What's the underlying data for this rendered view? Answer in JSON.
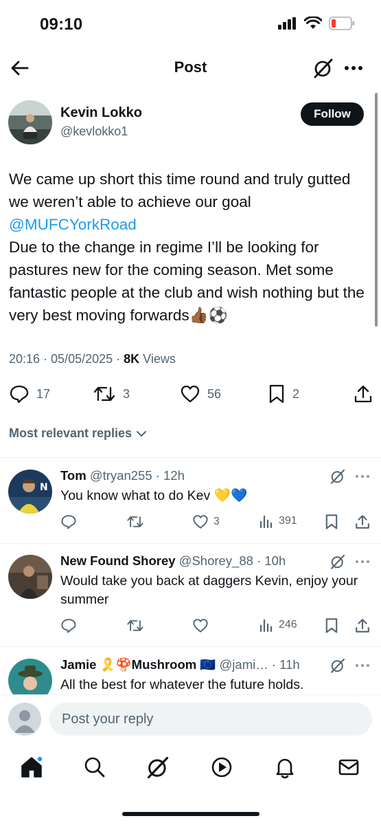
{
  "status_bar": {
    "time": "09:10"
  },
  "header": {
    "title": "Post"
  },
  "author": {
    "name": "Kevin Lokko",
    "handle": "@kevlokko1",
    "follow_label": "Follow"
  },
  "post": {
    "line1": "We came up short this time round and truly gutted we weren’t able to achieve our goal",
    "mention": "@MUFCYorkRoad",
    "line2": "Due to the change in regime I’ll be looking for pastures new for the coming season. Met some fantastic people at the club and wish nothing but the very best moving forwards👍🏾⚽️",
    "timestamp": "20:16 · 05/05/2025 · ",
    "views_count": "8K",
    "views_label": " Views"
  },
  "stats": {
    "replies": "17",
    "reposts": "3",
    "likes": "56",
    "bookmarks": "2"
  },
  "sort_label": "Most relevant replies",
  "replies": [
    {
      "name": "Tom",
      "handle": "@tryan255 · 12h",
      "text": "You know what to do Kev 💛💙",
      "likes": "3",
      "views": "391"
    },
    {
      "name": "New Found Shorey",
      "handle": "@Shorey_88 · 10h",
      "text": "Would take you back at daggers Kevin, enjoy your summer",
      "likes": "",
      "views": "246"
    },
    {
      "name": "Jamie 🎗️🍄Mushroom 🇪🇺",
      "handle": "@jami… · 11h",
      "text": "All the best for whatever the future holds."
    }
  ],
  "composer": {
    "placeholder": "Post your reply"
  },
  "colors": {
    "accent": "#1d9bf0",
    "text": "#0f1419",
    "muted": "#536471"
  }
}
